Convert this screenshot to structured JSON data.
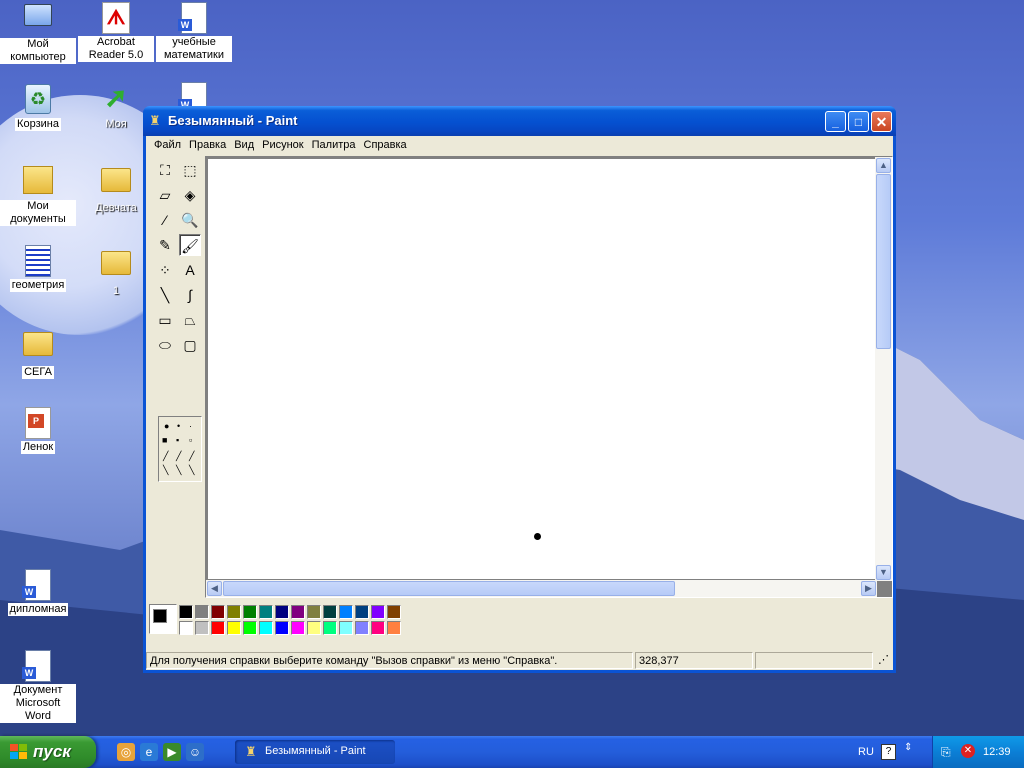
{
  "desktop": {
    "icons": [
      {
        "label": "Мой компьютер",
        "icon": "my-computer-icon"
      },
      {
        "label": "Acrobat Reader 5.0",
        "icon": "acrobat-reader-icon"
      },
      {
        "label": "учебные математики",
        "icon": "word-document-icon"
      },
      {
        "label": "Корзина",
        "icon": "recycle-bin-icon"
      },
      {
        "label": "Моя",
        "icon": "shortcut-arrow-icon"
      },
      {
        "label": "Мои документы",
        "icon": "my-documents-icon"
      },
      {
        "label": "Девчата",
        "icon": "folder-icon"
      },
      {
        "label": "геометрия",
        "icon": "document-icon"
      },
      {
        "label": "1",
        "icon": "folder-icon"
      },
      {
        "label": "СЕГА",
        "icon": "folder-icon"
      },
      {
        "label": "Ленок",
        "icon": "powerpoint-icon"
      },
      {
        "label": "дипломная",
        "icon": "word-document-icon"
      },
      {
        "label": "Документ Microsoft Word",
        "icon": "word-document-icon"
      }
    ]
  },
  "window": {
    "title": "Безымянный - Paint",
    "app_icon": "paint-icon",
    "buttons": {
      "minimize": "_",
      "maximize": "□",
      "close": "✕"
    },
    "menu": [
      "Файл",
      "Правка",
      "Вид",
      "Рисунок",
      "Палитра",
      "Справка"
    ],
    "tools": [
      {
        "name": "free-form-select-icon",
        "glyph": "⛶"
      },
      {
        "name": "select-icon",
        "glyph": "⬚"
      },
      {
        "name": "eraser-icon",
        "glyph": "▱"
      },
      {
        "name": "fill-bucket-icon",
        "glyph": "◈"
      },
      {
        "name": "pick-color-icon",
        "glyph": "⁄"
      },
      {
        "name": "magnifier-icon",
        "glyph": "🔍"
      },
      {
        "name": "pencil-icon",
        "glyph": "✎"
      },
      {
        "name": "brush-icon",
        "glyph": "🖌"
      },
      {
        "name": "airbrush-icon",
        "glyph": "⁘"
      },
      {
        "name": "text-icon",
        "glyph": "A"
      },
      {
        "name": "line-icon",
        "glyph": "╲"
      },
      {
        "name": "curve-icon",
        "glyph": "∫"
      },
      {
        "name": "rectangle-icon",
        "glyph": "▭"
      },
      {
        "name": "polygon-icon",
        "glyph": "⏢"
      },
      {
        "name": "ellipse-icon",
        "glyph": "⬭"
      },
      {
        "name": "rounded-rectangle-icon",
        "glyph": "▢"
      }
    ],
    "selected_tool": "brush-icon",
    "palette_top": [
      "#000000",
      "#808080",
      "#800000",
      "#808000",
      "#008000",
      "#008080",
      "#000080",
      "#800080",
      "#808040",
      "#004040",
      "#0080ff",
      "#004080",
      "#8000ff",
      "#804000"
    ],
    "palette_bottom": [
      "#ffffff",
      "#c0c0c0",
      "#ff0000",
      "#ffff00",
      "#00ff00",
      "#00ffff",
      "#0000ff",
      "#ff00ff",
      "#ffff80",
      "#00ff80",
      "#80ffff",
      "#8080ff",
      "#ff0080",
      "#ff8040"
    ],
    "foreground_color": "#000000",
    "background_color": "#ffffff",
    "status": {
      "help_text": "Для получения справки выберите команду \"Вызов справки\" из меню \"Справка\".",
      "coordinates": "328,377"
    }
  },
  "taskbar": {
    "start_label": "пуск",
    "quick_launch": [
      "show-desktop-icon",
      "internet-explorer-icon",
      "media-player-icon",
      "messenger-icon"
    ],
    "task_item": "Безымянный - Paint",
    "language": "RU",
    "clock": "12:39"
  }
}
